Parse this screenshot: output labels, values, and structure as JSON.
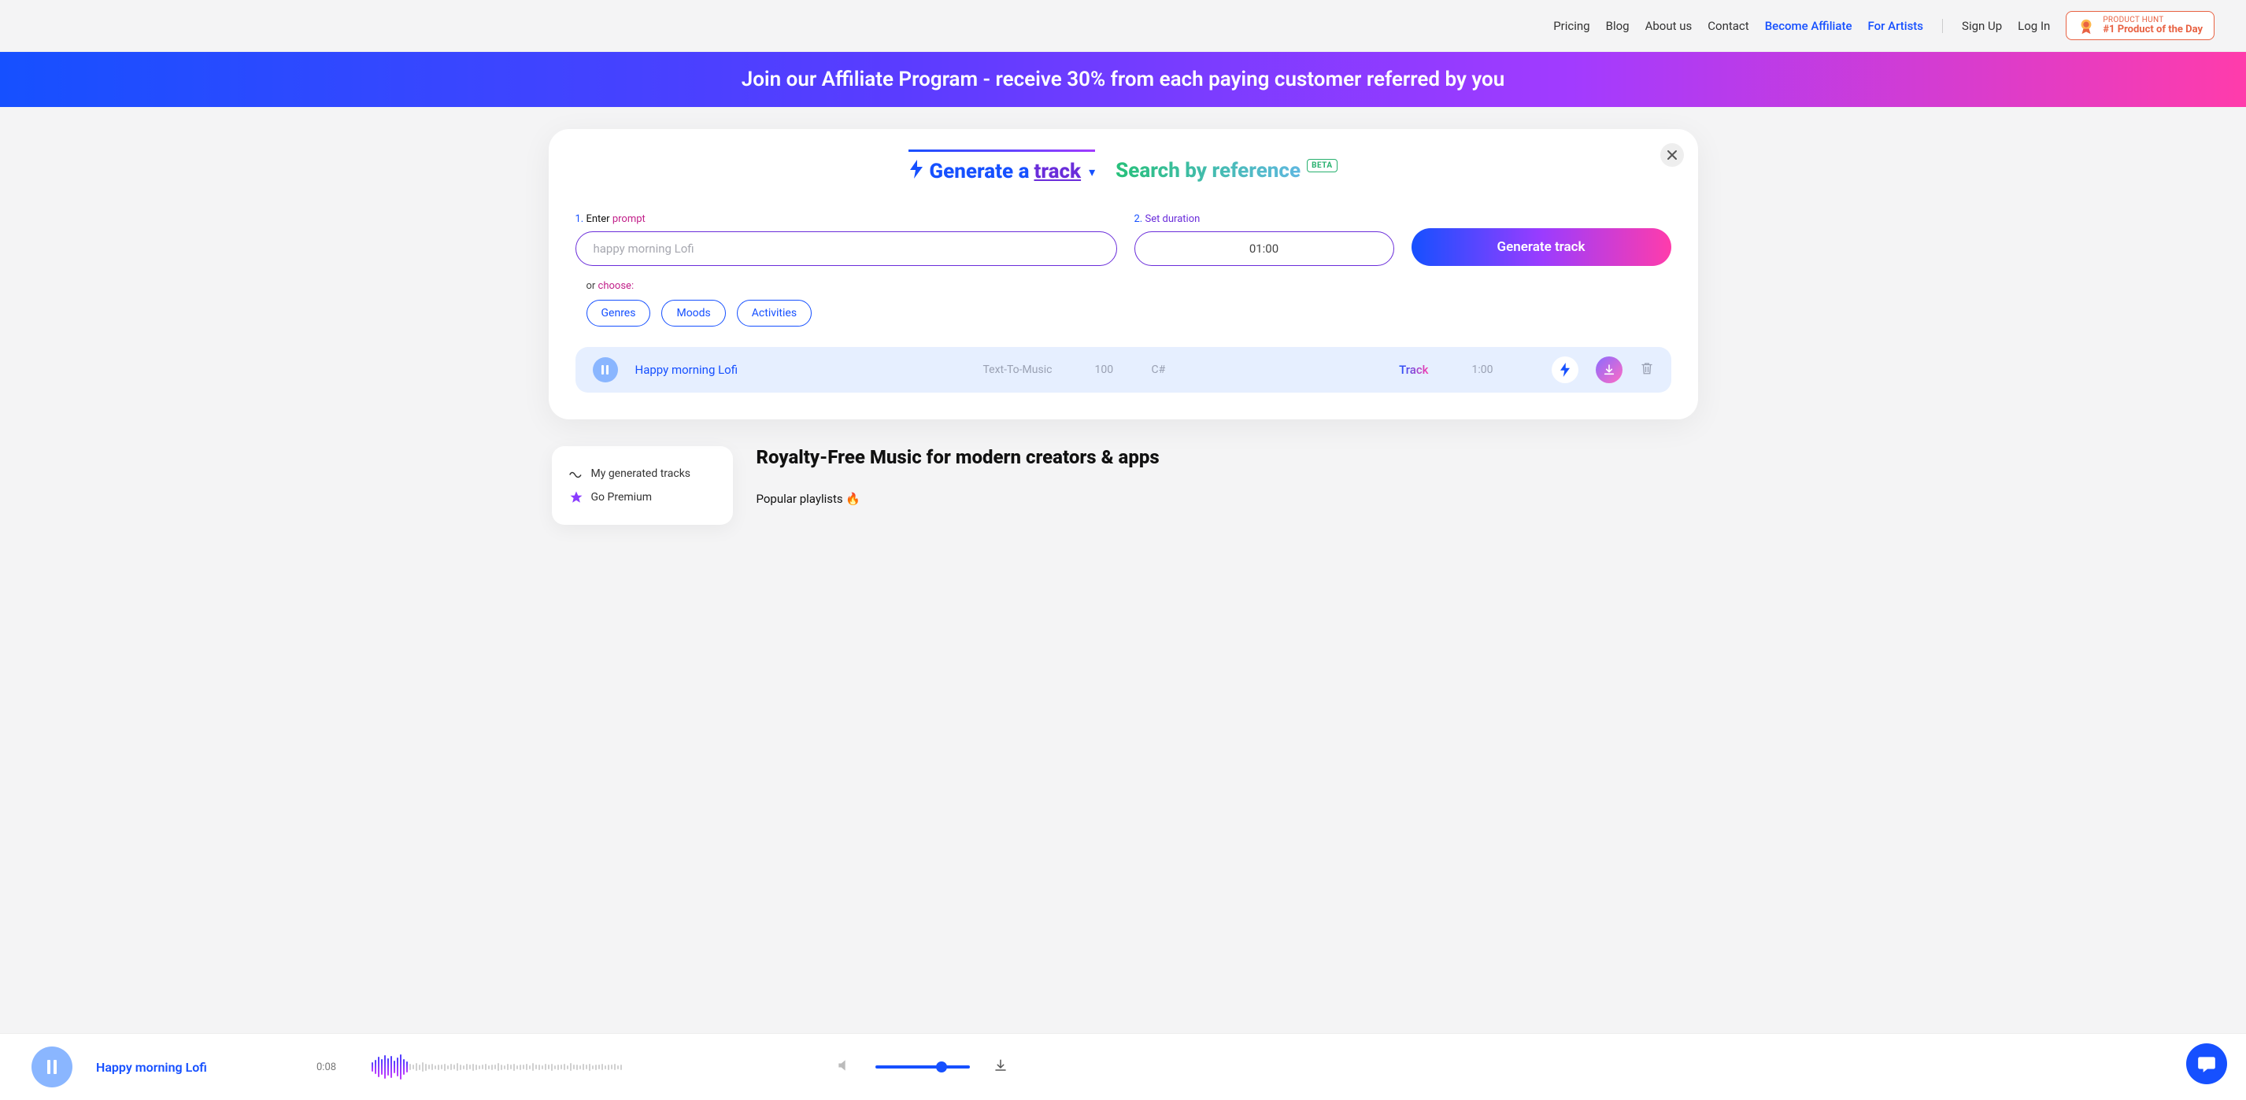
{
  "nav": {
    "pricing": "Pricing",
    "blog": "Blog",
    "about": "About us",
    "contact": "Contact",
    "affiliate": "Become Affiliate",
    "artists": "For Artists",
    "signup": "Sign Up",
    "login": "Log In"
  },
  "product_hunt": {
    "small": "PRODUCT HUNT",
    "big": "#1 Product of the Day"
  },
  "banner": "Join our Affiliate Program - receive 30% from each paying customer referred by you",
  "tabs": {
    "generate_prefix": "Generate a ",
    "generate_accent": "track",
    "search": "Search by reference",
    "beta": "BETA"
  },
  "form": {
    "prompt_label_num": "1. ",
    "prompt_label_a": "Enter ",
    "prompt_label_b": "prompt",
    "prompt_placeholder": "happy morning Lofi",
    "duration_label_num": "2. ",
    "duration_label": "Set duration",
    "duration_value": "01:00",
    "generate_btn": "Generate track",
    "or": "or ",
    "choose": "choose:",
    "chips": {
      "genres": "Genres",
      "moods": "Moods",
      "activities": "Activities"
    }
  },
  "track": {
    "title": "Happy morning Lofi",
    "source": "Text-To-Music",
    "bpm": "100",
    "key": "C#",
    "type": "Track",
    "duration": "1:00"
  },
  "sidebar": {
    "generated": "My generated tracks",
    "premium": "Go Premium"
  },
  "main": {
    "heading": "Royalty-Free Music for modern creators & apps",
    "popular": "Popular playlists 🔥"
  },
  "player": {
    "title": "Happy morning Lofi",
    "time": "0:08"
  }
}
